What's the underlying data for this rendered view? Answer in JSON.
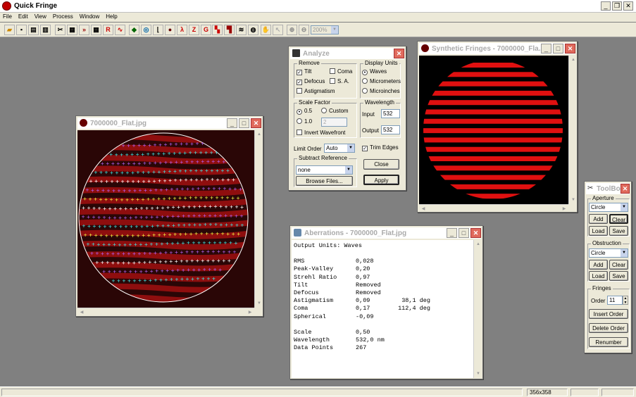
{
  "app": {
    "title": "Quick Fringe"
  },
  "menu": [
    "File",
    "Edit",
    "View",
    "Process",
    "Window",
    "Help"
  ],
  "toolbar": {
    "zoom_value": "200%"
  },
  "image_window": {
    "title": "7000000_Flat.jpg"
  },
  "synthetic_window": {
    "title": "Synthetic Fringes - 7000000_Fla..."
  },
  "analyze": {
    "title": "Analyze",
    "remove_label": "Remove",
    "tilt": "Tilt",
    "coma": "Coma",
    "defocus": "Defocus",
    "sa": "S. A.",
    "astigmatism": "Astigmatism",
    "display_units_label": "Display Units",
    "waves": "Waves",
    "micrometers": "Micrometers",
    "microinches": "Microinches",
    "scale_factor_label": "Scale Factor",
    "sf_05": "0.5",
    "sf_custom": "Custom",
    "sf_10": "1.0",
    "sf_custom_value": "2",
    "invert_wavefront": "Invert Wavefront",
    "wavelength_label": "Wavelength",
    "input_label": "Input",
    "input_value": "532",
    "output_label": "Output",
    "output_value": "532",
    "limit_order_label": "Limit Order",
    "limit_order_value": "Auto",
    "trim_edges": "Trim Edges",
    "subtract_reference_label": "Subtract Reference",
    "subtract_reference_value": "none",
    "browse_button": "Browse Files...",
    "close_button": "Close",
    "apply_button": "Apply"
  },
  "aberrations": {
    "title": "Aberrations - 7000000_Flat.jpg",
    "header": "Output Units: Waves",
    "rows": [
      {
        "name": "RMS",
        "value": "0,028",
        "extra": ""
      },
      {
        "name": "Peak-Valley",
        "value": "0,20",
        "extra": ""
      },
      {
        "name": "Strehl Ratio",
        "value": "0,97",
        "extra": ""
      },
      {
        "name": "Tilt",
        "value": "Removed",
        "extra": ""
      },
      {
        "name": "Defocus",
        "value": "Removed",
        "extra": ""
      },
      {
        "name": "Astigmatism",
        "value": "0,09",
        "extra": "38,1 deg"
      },
      {
        "name": "Coma",
        "value": "0,17",
        "extra": "112,4 deg"
      },
      {
        "name": "Spherical",
        "value": "-0,09",
        "extra": ""
      }
    ],
    "footer_rows": [
      {
        "name": "Scale",
        "value": "0,50"
      },
      {
        "name": "Wavelength",
        "value": "532,0 nm"
      },
      {
        "name": "Data Points",
        "value": "267"
      }
    ]
  },
  "toolbox": {
    "title": "ToolBox",
    "aperture_label": "Aperture",
    "aperture_value": "Circle",
    "obstruction_label": "Obstruction",
    "obstruction_value": "Circle",
    "add": "Add",
    "clear": "Clear",
    "load": "Load",
    "save": "Save",
    "fringes_label": "Fringes",
    "order_label": "Order",
    "order_value": "11",
    "insert_order": "Insert Order",
    "delete_order": "Delete Order",
    "renumber": "Renumber"
  },
  "status": {
    "size": "356x358"
  },
  "colors": {
    "fringe_red": "#e01010",
    "trace_white": "#ffffff",
    "trace_cyan": "#40e0e0",
    "trace_purple": "#b060f0",
    "trace_yellow": "#f0f040"
  }
}
